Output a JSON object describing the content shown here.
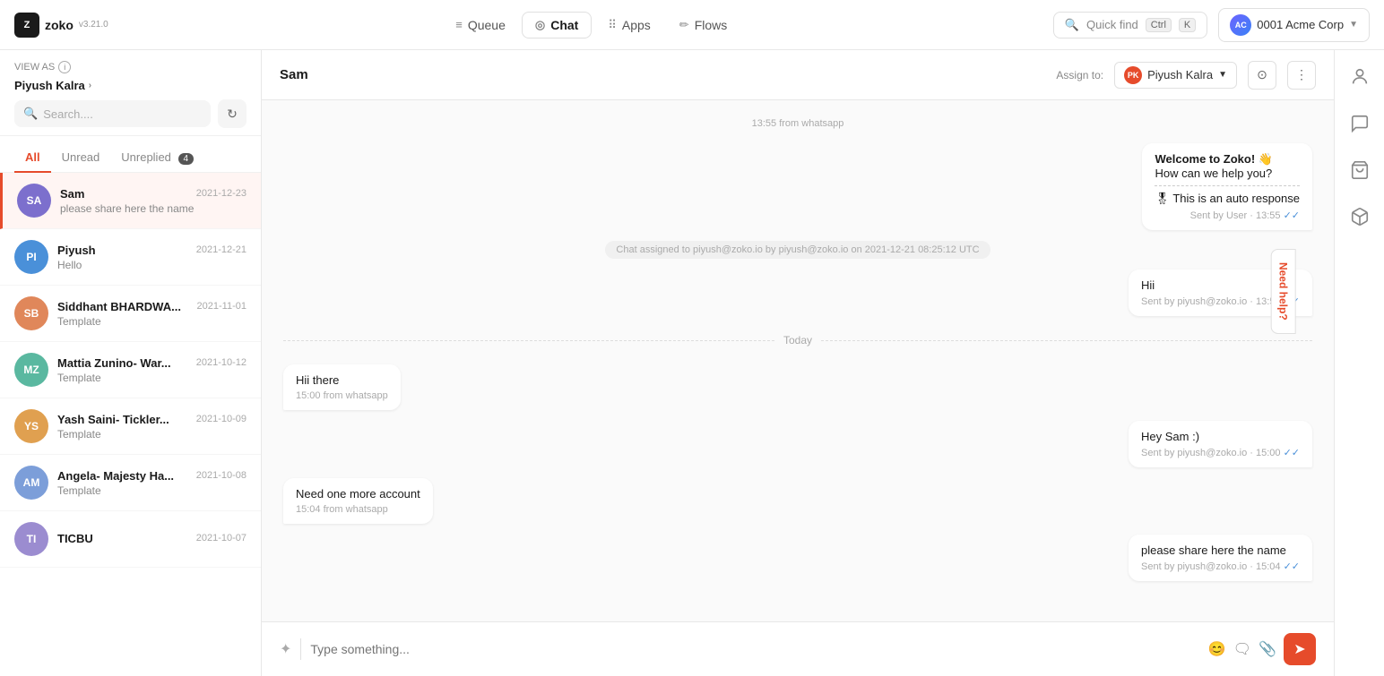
{
  "app": {
    "logo_text": "Z",
    "logo_name": "zoko",
    "logo_version": "v3.21.0"
  },
  "nav": {
    "queue_label": "Queue",
    "chat_label": "Chat",
    "apps_label": "Apps",
    "flows_label": "Flows",
    "quick_find_label": "Quick find",
    "kbd_ctrl": "Ctrl",
    "kbd_k": "K",
    "account_label": "0001 Acme Corp",
    "account_avatar": "AC"
  },
  "sidebar": {
    "view_as_label": "VIEW AS",
    "view_as_name": "Piyush Kalra",
    "search_placeholder": "Search....",
    "filter_tabs": [
      {
        "id": "all",
        "label": "All",
        "active": true
      },
      {
        "id": "unread",
        "label": "Unread",
        "active": false
      },
      {
        "id": "unreplied",
        "label": "Unreplied",
        "count": "4",
        "active": false
      }
    ],
    "chats": [
      {
        "id": "sam",
        "initials": "SA",
        "name": "Sam",
        "date": "2021-12-23",
        "preview": "please share here the name",
        "avatar_class": "avatar-sa",
        "active": true
      },
      {
        "id": "piyush",
        "initials": "PI",
        "name": "Piyush",
        "date": "2021-12-21",
        "preview": "Hello",
        "avatar_class": "avatar-pi",
        "active": false
      },
      {
        "id": "siddhant",
        "initials": "SB",
        "name": "Siddhant BHARDWA...",
        "date": "2021-11-01",
        "preview": "Template",
        "avatar_class": "avatar-sb",
        "active": false
      },
      {
        "id": "mattia",
        "initials": "MZ",
        "name": "Mattia Zunino- War...",
        "date": "2021-10-12",
        "preview": "Template",
        "avatar_class": "avatar-mz",
        "active": false
      },
      {
        "id": "yash",
        "initials": "YS",
        "name": "Yash Saini- Tickler...",
        "date": "2021-10-09",
        "preview": "Template",
        "avatar_class": "avatar-ys",
        "active": false
      },
      {
        "id": "angela",
        "initials": "AM",
        "name": "Angela- Majesty Ha...",
        "date": "2021-10-08",
        "preview": "Template",
        "avatar_class": "avatar-am",
        "active": false
      },
      {
        "id": "ticbu",
        "initials": "TI",
        "name": "TICBU",
        "date": "2021-10-07",
        "preview": "",
        "avatar_class": "avatar-ti",
        "active": false
      }
    ]
  },
  "chat_header": {
    "contact_name": "Sam",
    "assign_to_label": "Assign to:",
    "assignee_name": "Piyush Kalra",
    "assignee_initials": "PK"
  },
  "messages": [
    {
      "type": "time_label",
      "text": "13:55 from whatsapp"
    },
    {
      "type": "right_bubble_auto",
      "welcome": "Welcome to Zoko! 👋",
      "subtext": "How can we help you?",
      "divider": true,
      "auto_text": "🎖 This is an auto response",
      "meta": "Sent by User · 13:55"
    },
    {
      "type": "system",
      "text": "Chat assigned to piyush@zoko.io by piyush@zoko.io on 2021-12-21 08:25:12 UTC"
    },
    {
      "type": "right_bubble",
      "text": "Hii",
      "meta": "Sent by piyush@zoko.io · 13:55"
    },
    {
      "type": "today_divider",
      "text": "Today"
    },
    {
      "type": "left_bubble",
      "text": "Hii there",
      "meta": "15:00 from whatsapp"
    },
    {
      "type": "right_bubble",
      "text": "Hey Sam :)",
      "meta": "Sent by piyush@zoko.io · 15:00"
    },
    {
      "type": "left_bubble",
      "text": "Need one more account",
      "meta": "15:04 from whatsapp"
    },
    {
      "type": "right_bubble",
      "text": "please share here the name",
      "meta": "Sent by piyush@zoko.io · 15:04"
    }
  ],
  "input": {
    "placeholder": "Type something..."
  },
  "need_help": "Need help?",
  "right_sidebar_icons": [
    {
      "id": "profile",
      "symbol": "👤"
    },
    {
      "id": "chat-bubble",
      "symbol": "💬"
    },
    {
      "id": "shopping",
      "symbol": "🛍"
    },
    {
      "id": "box",
      "symbol": "📦"
    }
  ]
}
